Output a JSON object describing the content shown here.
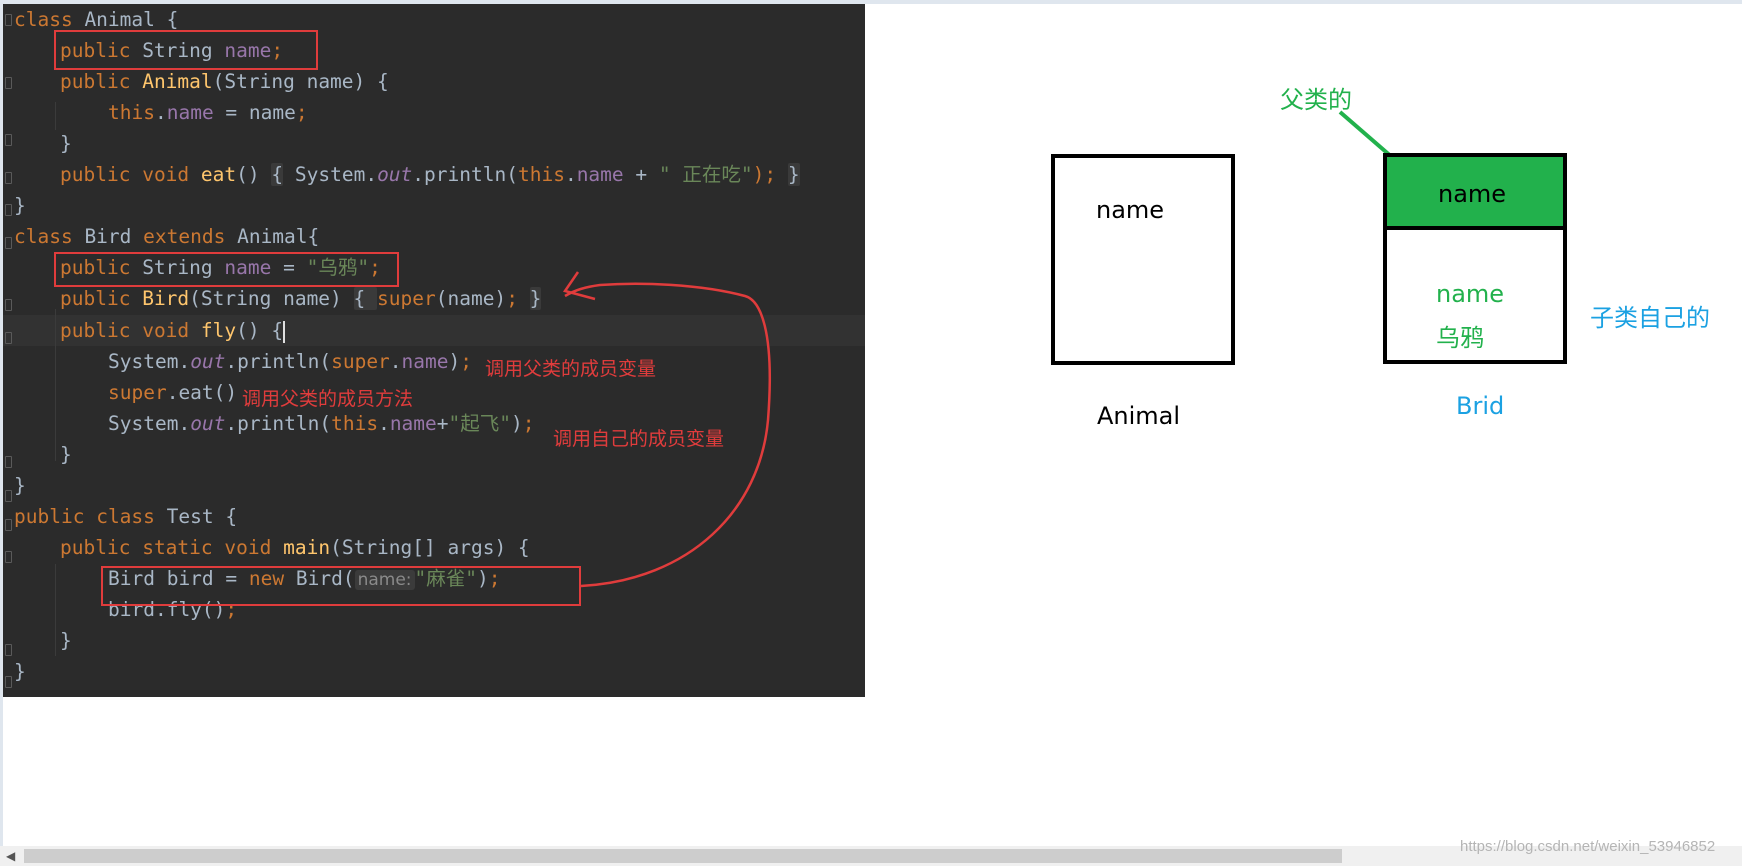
{
  "code": {
    "l1": {
      "kw": "class",
      "name": " Animal {"
    },
    "l2": {
      "kw": "public",
      "type": " String ",
      "fld": "name",
      "end": ";"
    },
    "l3": {
      "kw": "public",
      "fn": "Animal",
      "rest": "(String name) {"
    },
    "l4": {
      "this": "this",
      "dot": ".",
      "fld": "name",
      "mid": " = name",
      "end": ";"
    },
    "l5": {
      "text": "}"
    },
    "l6": {
      "kw1": "public",
      "kw2": "void",
      "fn": "eat",
      "p1": "()",
      "b1": "{",
      "sys": " System.",
      "out": "out",
      "pr": ".println(",
      "this": "this",
      "dot": ".",
      "fld": "name",
      "plus": " + ",
      "str": "\" 正在吃\"",
      "close": ");",
      "b2": "}"
    },
    "l7": {
      "text": "}"
    },
    "l8": {
      "kw": "class",
      "mid": " Bird ",
      "kw2": "extends",
      "end": " Animal{"
    },
    "l9": {
      "kw": "public",
      "type": " String ",
      "fld": "name",
      "eq": " = ",
      "str": "\"乌鸦\"",
      "end": ";"
    },
    "l10": {
      "kw": "public",
      "fn": "Bird",
      "rest": "(String name) ",
      "b1": "{ ",
      "sup": "super",
      "call": "(name)",
      "end": "; ",
      "b2": "}"
    },
    "l11": {
      "kw1": "public",
      "kw2": "void",
      "fn": "fly",
      "rest": "() {"
    },
    "l12": {
      "sys": "System.",
      "out": "out",
      "pr": ".println(",
      "sup": "super",
      "dot": ".",
      "fld": "name",
      "close": ")",
      "end": ";"
    },
    "l13": {
      "sup": "super",
      "rest": ".eat()"
    },
    "l14": {
      "sys": "System.",
      "out": "out",
      "pr": ".println(",
      "this": "this",
      "dot": ".",
      "fld": "name",
      "plus": "+",
      "str": "\"起飞\"",
      "close": ")",
      "end": ";"
    },
    "l15": {
      "text": "}"
    },
    "l16": {
      "text": "}"
    },
    "l17": {
      "kw": "public",
      "kw2": "class",
      "rest": " Test {"
    },
    "l18": {
      "kw1": "public",
      "kw2": "static",
      "kw3": "void",
      "fn": "main",
      "rest": "(String[] args) {"
    },
    "l19": {
      "pre": "Bird bird = ",
      "kw": "new",
      "mid": " Bird(",
      "hint": "name:",
      "str": "\"麻雀\"",
      "close": ")",
      "end": ";"
    },
    "l20": {
      "pre": "bird.fly()",
      "end": ";"
    },
    "l21": {
      "text": "}"
    },
    "l22": {
      "text": "}"
    }
  },
  "annotations": {
    "call_parent_field": "调用父类的成员变量",
    "call_parent_method": "调用父类的成员方法",
    "call_own_field": "调用自己的成员变量"
  },
  "diagram": {
    "animal_field": "name",
    "animal_label": "Animal",
    "parent_label": "父类的",
    "bird_parent_field": "name",
    "bird_own_field": "name",
    "bird_own_value": "乌鸦",
    "child_label": "子类自己的",
    "bird_label": "Brid",
    "colors": {
      "green": "#22b14c",
      "blue": "#1ba1e2",
      "red": "#e03c3c"
    }
  },
  "watermark": "https://blog.csdn.net/weixin_53946852"
}
